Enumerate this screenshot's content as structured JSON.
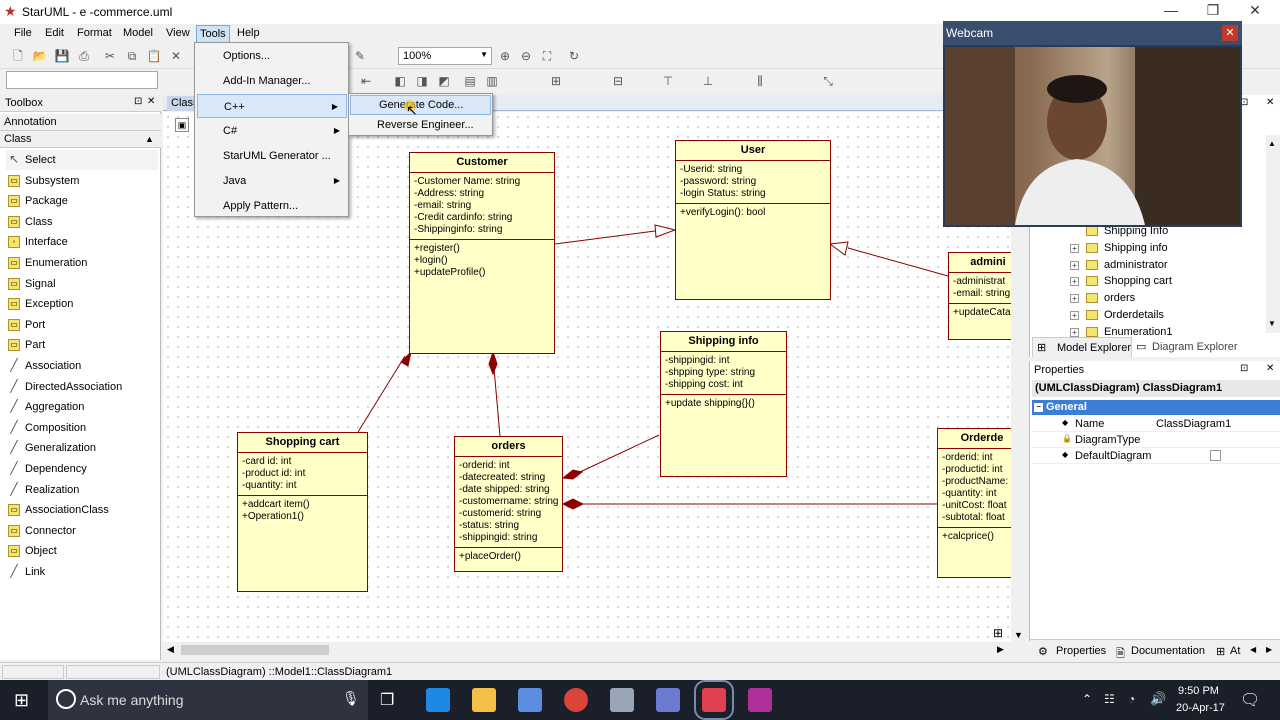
{
  "window": {
    "title": "StarUML - e -commerce.uml",
    "minimize": "—",
    "maximize": "❐",
    "close": "✕"
  },
  "menubar": [
    "File",
    "Edit",
    "Format",
    "Model",
    "View",
    "Tools",
    "Help"
  ],
  "toolbar": {
    "zoom": "100%"
  },
  "toolbox": {
    "title": "Toolbox",
    "sections": {
      "annotation": "Annotation",
      "class": "Class"
    },
    "items": [
      "Select",
      "Subsystem",
      "Package",
      "Class",
      "Interface",
      "Enumeration",
      "Signal",
      "Exception",
      "Port",
      "Part",
      "Association",
      "DirectedAssociation",
      "Aggregation",
      "Composition",
      "Generalization",
      "Dependency",
      "Realization",
      "AssociationClass",
      "Connector",
      "Object",
      "Link"
    ]
  },
  "diagram_tab": "ClassDiagram1",
  "tools_menu": {
    "items": [
      "Options...",
      "Add-In Manager...",
      "C++",
      "C#",
      "StarUML Generator ...",
      "Java",
      "Apply Pattern..."
    ]
  },
  "cpp_submenu": {
    "items": [
      "Generate Code...",
      "Reverse Engineer..."
    ]
  },
  "classes": {
    "customer": {
      "name": "Customer",
      "attrs": [
        "-Customer Name: string",
        "-Address: string",
        "-email: string",
        "-Credit cardinfo: string",
        "-Shippinginfo: string"
      ],
      "ops": [
        "+register()",
        "+login()",
        "+updateProfile()"
      ]
    },
    "user": {
      "name": "User",
      "attrs": [
        "-Userid: string",
        "-password: string",
        "-login Status: string"
      ],
      "ops": [
        "+verifyLogin(): bool"
      ]
    },
    "admin": {
      "name": "admini",
      "attrs": [
        "-administrat",
        "-email: string"
      ],
      "ops": [
        "+updateCata"
      ]
    },
    "shippinginfo": {
      "name": "Shipping info",
      "attrs": [
        "-shippingid: int",
        "-shpping type: string",
        "-shipping cost: int"
      ],
      "ops": [
        "+update shipping{}()"
      ]
    },
    "shoppingcart": {
      "name": "Shopping cart",
      "attrs": [
        "-card id: int",
        "-product id: int",
        "-quantity: int"
      ],
      "ops": [
        "+addcart item()",
        "+Operation1()"
      ]
    },
    "orders": {
      "name": "orders",
      "attrs": [
        "-orderid: int",
        "-datecreated: string",
        "-date shipped: string",
        "-customername: string",
        "-customerid: string",
        "-status: string",
        "-shippingid: string"
      ],
      "ops": [
        "+placeOrder()"
      ]
    },
    "orderdetails": {
      "name": "Orderde",
      "attrs": [
        "-orderid: int",
        "-productid: int",
        "-productName:",
        "-quantity: int",
        "-unitCost: float",
        "-subtotal: float"
      ],
      "ops": [
        "+calcprice()"
      ]
    }
  },
  "model_explorer": {
    "tree": [
      "Shipping Info",
      "Shipping info",
      "administrator",
      "Shopping cart",
      "orders",
      "Orderdetails",
      "Enumeration1"
    ],
    "tabs": [
      "Model Explorer",
      "Diagram Explorer"
    ]
  },
  "properties": {
    "title": "Properties",
    "selected": "(UMLClassDiagram) ClassDiagram1",
    "group": "General",
    "rows": [
      {
        "key": "Name",
        "value": "ClassDiagram1"
      },
      {
        "key": "DiagramType",
        "value": ""
      },
      {
        "key": "DefaultDiagram",
        "value": ""
      }
    ],
    "tabs": [
      "Properties",
      "Documentation",
      "At"
    ]
  },
  "statusbar": {
    "path": "(UMLClassDiagram) ::Model1::ClassDiagram1"
  },
  "webcam": {
    "title": "Webcam"
  },
  "taskbar": {
    "search_placeholder": "Ask me anything",
    "time": "9:50 PM",
    "date": "20-Apr-17"
  }
}
